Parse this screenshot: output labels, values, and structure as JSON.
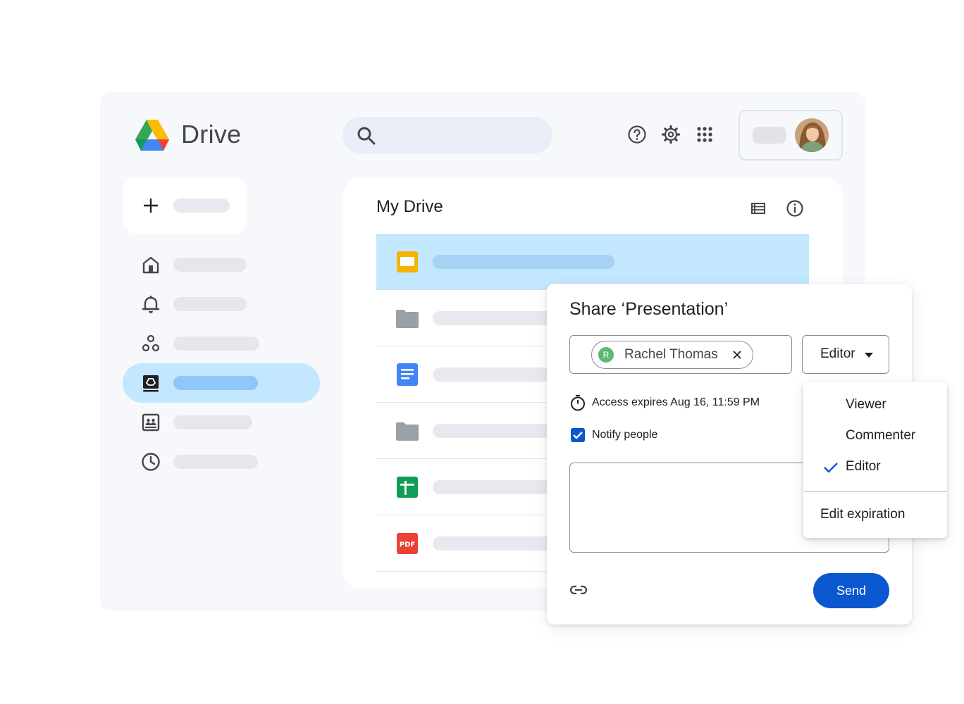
{
  "app": {
    "name": "Drive",
    "icons": [
      "drive-logo-icon",
      "search-icon",
      "help-icon",
      "settings-icon",
      "apps-grid-icon"
    ]
  },
  "sidebar": {
    "items": [
      {
        "id": "home",
        "icon": "home-icon",
        "active": false
      },
      {
        "id": "activity",
        "icon": "bell-icon",
        "active": false
      },
      {
        "id": "workspaces",
        "icon": "workspaces-icon",
        "active": false
      },
      {
        "id": "my-drive",
        "icon": "drive-folder-icon",
        "active": true
      },
      {
        "id": "shared",
        "icon": "shared-drive-icon",
        "active": false
      },
      {
        "id": "recent",
        "icon": "clock-icon",
        "active": false
      }
    ]
  },
  "main": {
    "title": "My Drive",
    "files": [
      {
        "type": "slides",
        "icon": "slides-icon",
        "selected": true
      },
      {
        "type": "folder",
        "icon": "folder-icon",
        "selected": false
      },
      {
        "type": "docs",
        "icon": "docs-icon",
        "selected": false
      },
      {
        "type": "folder",
        "icon": "folder-icon",
        "selected": false
      },
      {
        "type": "sheets",
        "icon": "sheets-icon",
        "selected": false
      },
      {
        "type": "pdf",
        "icon": "pdf-icon",
        "label": "PDF",
        "selected": false
      }
    ]
  },
  "share_dialog": {
    "title": "Share ‘Presentation’",
    "recipient": {
      "initial": "R",
      "name": "Rachel Thomas"
    },
    "role": "Editor",
    "expiry_text": "Access expires Aug 16, 11:59 PM",
    "notify_label": "Notify people",
    "notify_checked": true,
    "send_label": "Send"
  },
  "role_menu": {
    "options": [
      "Viewer",
      "Commenter",
      "Editor"
    ],
    "selected": "Editor",
    "expiration_label": "Edit expiration"
  },
  "colors": {
    "accent": "#0b57d0",
    "selection": "#c2e7ff",
    "frame_background": "#f6f8fc"
  }
}
